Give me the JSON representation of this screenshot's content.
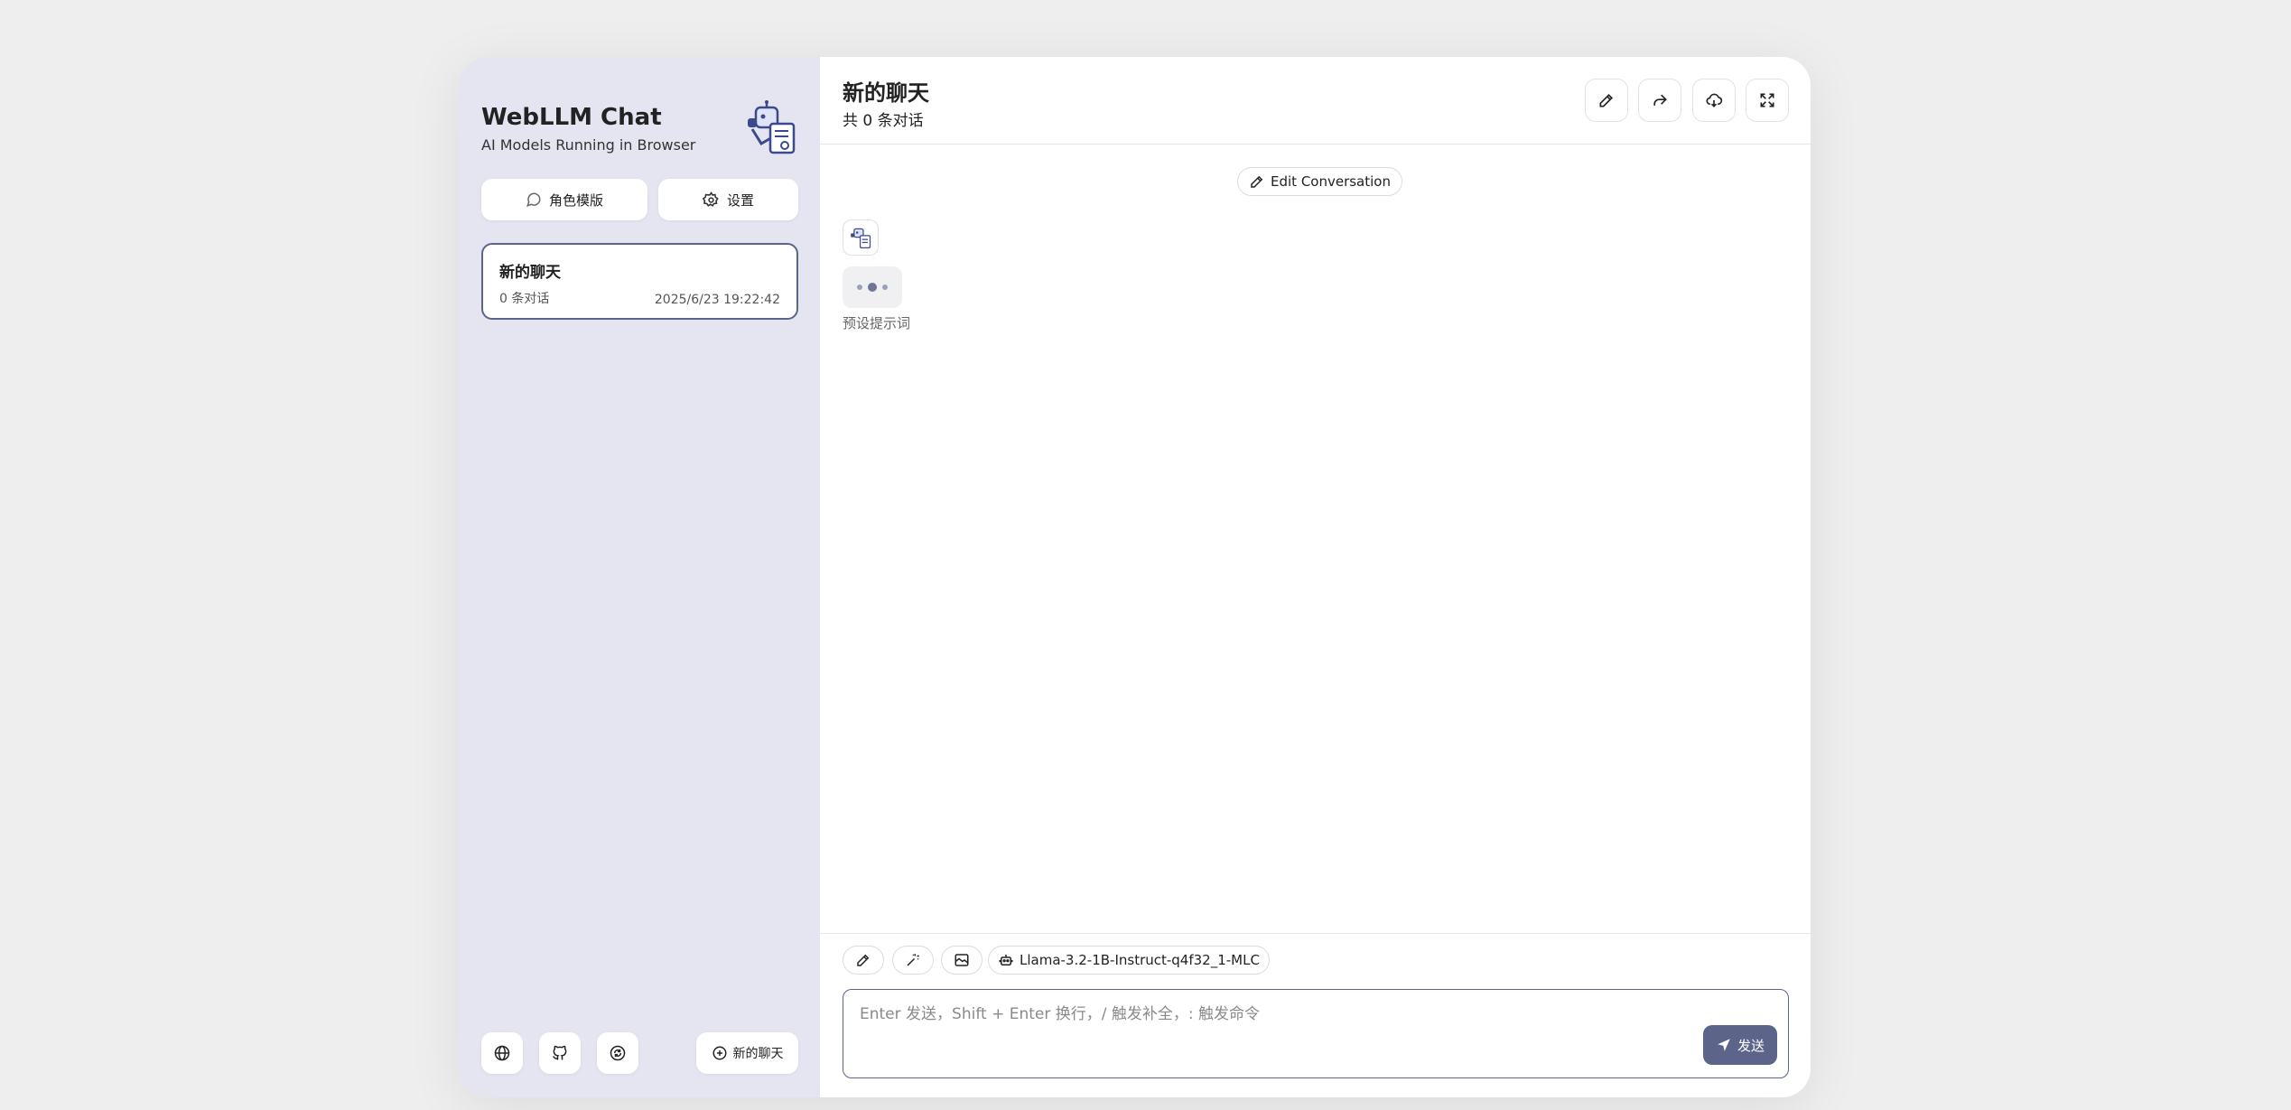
{
  "sidebar": {
    "title": "WebLLM Chat",
    "subtitle": "AI Models Running in Browser",
    "mask_button": "角色模版",
    "settings_button": "设置",
    "chats": [
      {
        "title": "新的聊天",
        "count": "0 条对话",
        "time": "2025/6/23 19:22:42"
      }
    ],
    "new_chat_button": "新的聊天"
  },
  "header": {
    "title": "新的聊天",
    "subtitle": "共 0 条对话"
  },
  "messages": {
    "edit_conversation": "Edit Conversation",
    "preset_label": "预设提示词"
  },
  "input": {
    "model_chip": "Llama-3.2-1B-Instruct-q4f32_1-MLC",
    "placeholder": "Enter 发送，Shift + Enter 换行，/ 触发补全，: 触发命令",
    "send_label": "发送"
  },
  "colors": {
    "accent": "#5c648a",
    "sidebar_bg": "#e4e5f1",
    "page_bg": "#eeeeef"
  },
  "icons": [
    "robot-logo-icon",
    "chat-bubble-icon",
    "gear-icon",
    "globe-icon",
    "github-icon",
    "sync-icon",
    "plus-circle-icon",
    "pencil-icon",
    "share-icon",
    "download-cloud-icon",
    "maximize-icon",
    "magic-wand-icon",
    "image-icon",
    "robot-icon",
    "send-icon"
  ]
}
